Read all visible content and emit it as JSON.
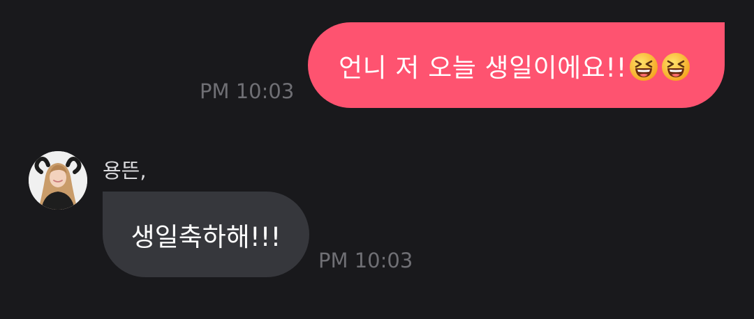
{
  "messages": {
    "outgoing": {
      "text": "언니 저 오늘 생일이에요!!",
      "emoji_icons": [
        "laughing-face-emoji",
        "laughing-face-emoji"
      ],
      "time": "PM 10:03"
    },
    "incoming": {
      "sender": "용뜬,",
      "text": "생일축하해!!!",
      "time": "PM 10:03"
    }
  },
  "colors": {
    "background": "#19191c",
    "outgoing_bubble": "#fe5370",
    "incoming_bubble": "#36373c",
    "timestamp": "#6f6f74"
  }
}
